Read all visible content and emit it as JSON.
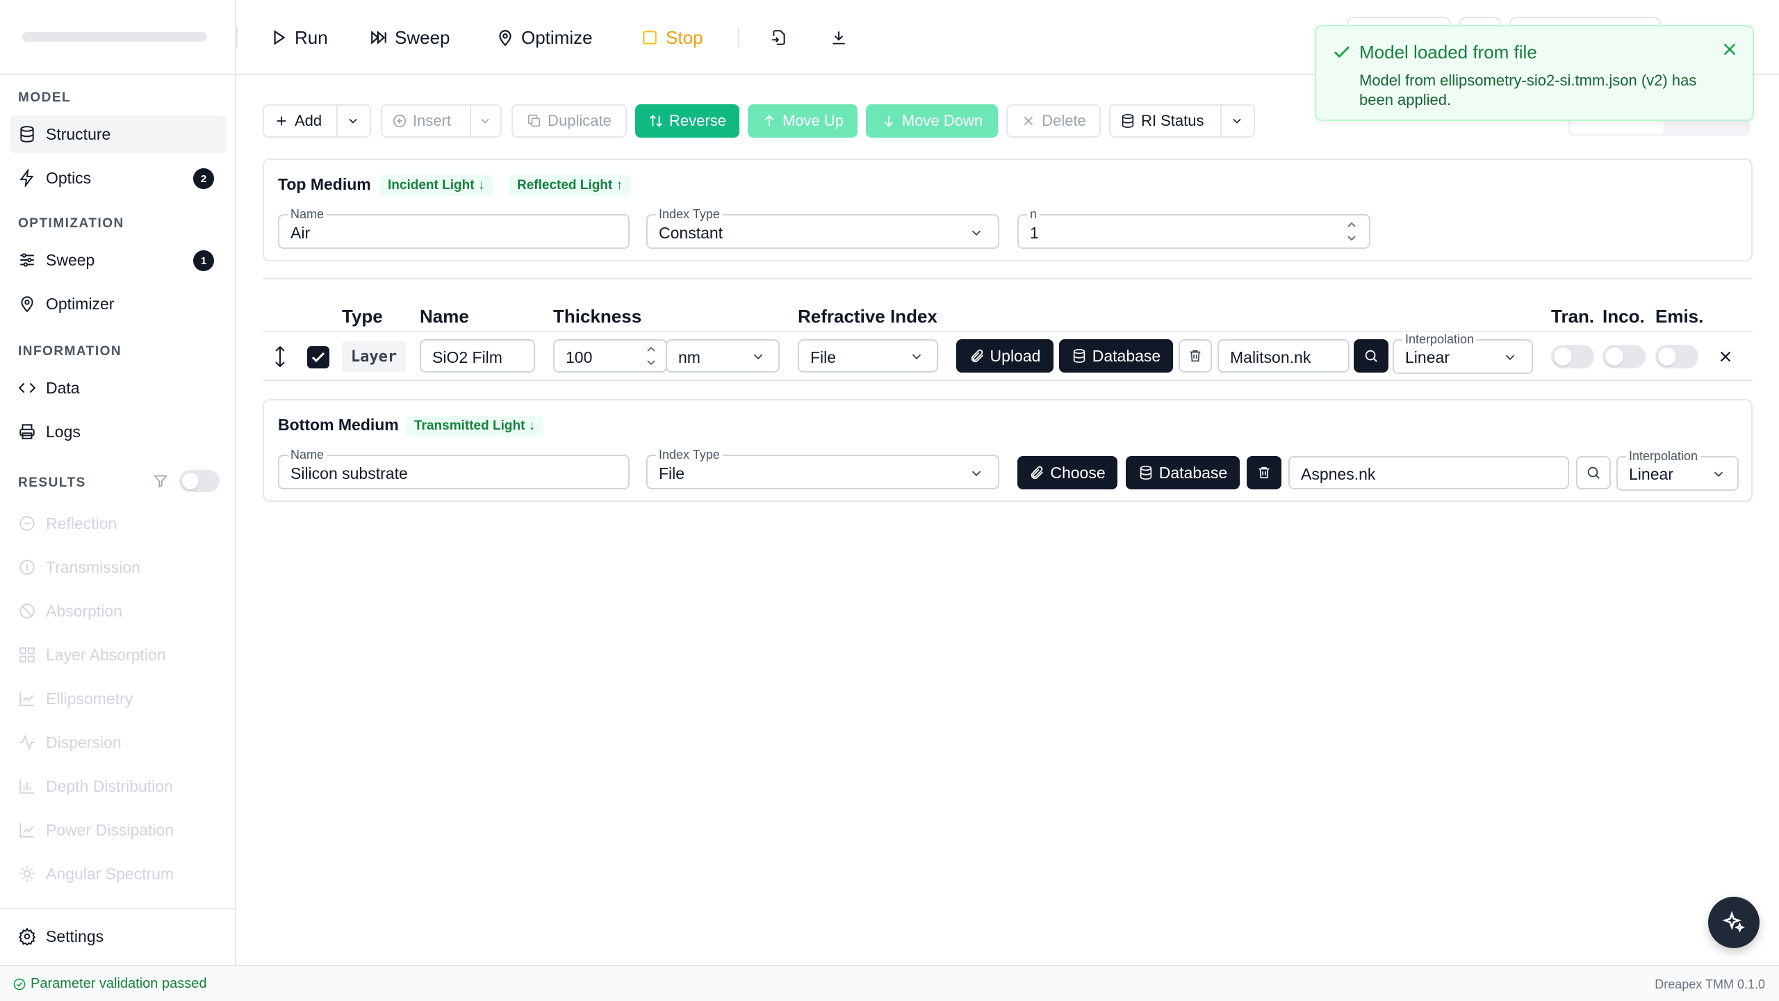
{
  "sidebar": {
    "sections": {
      "model": "MODEL",
      "optimization": "OPTIMIZATION",
      "information": "INFORMATION",
      "results": "RESULTS"
    },
    "items": {
      "structure": "Structure",
      "optics": "Optics",
      "optics_badge": "2",
      "sweep": "Sweep",
      "sweep_badge": "1",
      "optimizer": "Optimizer",
      "data": "Data",
      "logs": "Logs",
      "reflection": "Reflection",
      "transmission": "Transmission",
      "absorption": "Absorption",
      "layer_absorption": "Layer Absorption",
      "ellipsometry": "Ellipsometry",
      "dispersion": "Dispersion",
      "depth_distribution": "Depth Distribution",
      "power_dissipation": "Power Dissipation",
      "angular_spectrum": "Angular Spectrum",
      "settings": "Settings"
    }
  },
  "toolbar": {
    "run": "Run",
    "sweep": "Sweep",
    "optimize": "Optimize",
    "stop": "Stop"
  },
  "toast": {
    "title": "Model loaded from file",
    "body": "Model from ellipsometry-sio2-si.tmm.json (v2) has been applied."
  },
  "actions": {
    "add": "Add",
    "insert": "Insert",
    "duplicate": "Duplicate",
    "reverse": "Reverse",
    "move_up": "Move Up",
    "move_down": "Move Down",
    "delete": "Delete",
    "ri_status": "RI Status"
  },
  "top_medium": {
    "title": "Top Medium",
    "tag_incident": "Incident Light ↓",
    "tag_reflected": "Reflected Light ↑",
    "name_label": "Name",
    "name_value": "Air",
    "index_type_label": "Index Type",
    "index_type_value": "Constant",
    "n_label": "n",
    "n_value": "1"
  },
  "table": {
    "headers": {
      "type": "Type",
      "name": "Name",
      "thickness": "Thickness",
      "refractive_index": "Refractive Index",
      "tran": "Tran.",
      "inco": "Inco.",
      "emis": "Emis."
    },
    "rows": [
      {
        "type": "Layer",
        "name": "SiO2 Film",
        "thickness": "100",
        "unit": "nm",
        "ri_source": "File",
        "upload": "Upload",
        "database": "Database",
        "file": "Malitson.nk",
        "interp_label": "Interpolation",
        "interp_value": "Linear"
      }
    ]
  },
  "bottom_medium": {
    "title": "Bottom Medium",
    "tag_transmitted": "Transmitted Light ↓",
    "name_label": "Name",
    "name_value": "Silicon substrate",
    "index_type_label": "Index Type",
    "index_type_value": "File",
    "choose": "Choose",
    "database": "Database",
    "file": "Aspnes.nk",
    "interp_label": "Interpolation",
    "interp_value": "Linear"
  },
  "status": {
    "left": "Parameter validation passed",
    "right": "Dreapex TMM 0.1.0"
  },
  "colors": {
    "accent_green": "#10b981",
    "dark": "#111827",
    "stop_orange": "#f59e0b"
  }
}
